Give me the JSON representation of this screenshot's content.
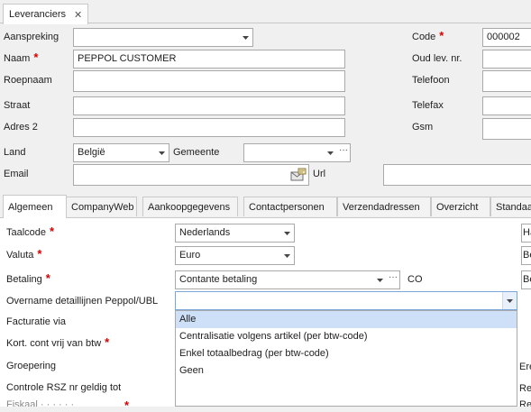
{
  "doc_tab": {
    "label": "Leveranciers",
    "close": "✕"
  },
  "header_form": {
    "aanspreking_label": "Aanspreking",
    "aanspreking_value": "",
    "naam_label": "Naam",
    "naam_value": "PEPPOL CUSTOMER",
    "roepnaam_label": "Roepnaam",
    "straat_label": "Straat",
    "adres2_label": "Adres 2",
    "land_label": "Land",
    "land_value": "België",
    "gemeente_label": "Gemeente",
    "gemeente_value": "",
    "email_label": "Email",
    "url_label": "Url",
    "code_label": "Code",
    "code_value": "000002",
    "oud_lev_label": "Oud lev. nr.",
    "telefoon_label": "Telefoon",
    "telefax_label": "Telefax",
    "gsm_label": "Gsm",
    "required_mark": "*",
    "ellipsis": "···"
  },
  "tabs": [
    {
      "label": "Algemeen"
    },
    {
      "label": "CompanyWeb"
    },
    {
      "label": "Aankoopgegevens"
    },
    {
      "label": "Contactpersonen"
    },
    {
      "label": "Verzendadressen"
    },
    {
      "label": "Overzicht"
    },
    {
      "label": "Standaa"
    }
  ],
  "algemeen": {
    "taalcode_label": "Taalcode",
    "taalcode_value": "Nederlands",
    "valuta_label": "Valuta",
    "valuta_value": "Euro",
    "betaling_label": "Betaling",
    "betaling_value": "Contante betaling",
    "betaling_suffix": "CO",
    "overname_label": "Overname detaillijnen Peppol/UBL",
    "overname_value": "",
    "facturatie_label": "Facturatie via",
    "kort_label": "Kort. cont vrij van btw",
    "groepering_label": "Groepering",
    "controle_label": "Controle RSZ nr geldig tot",
    "right_col": [
      "Ha",
      "Be",
      "Be",
      "Ere",
      "Re",
      "Re"
    ]
  },
  "dropdown_options": [
    {
      "label": "Alle",
      "selected": true
    },
    {
      "label": "Centralisatie volgens artikel (per btw-code)",
      "selected": false
    },
    {
      "label": "Enkel totaalbedrag (per btw-code)",
      "selected": false
    },
    {
      "label": "Geen",
      "selected": false
    }
  ],
  "colors": {
    "required": "#d40000",
    "selected_option": "#cde0f7",
    "focus_border": "#7aa7d8"
  }
}
